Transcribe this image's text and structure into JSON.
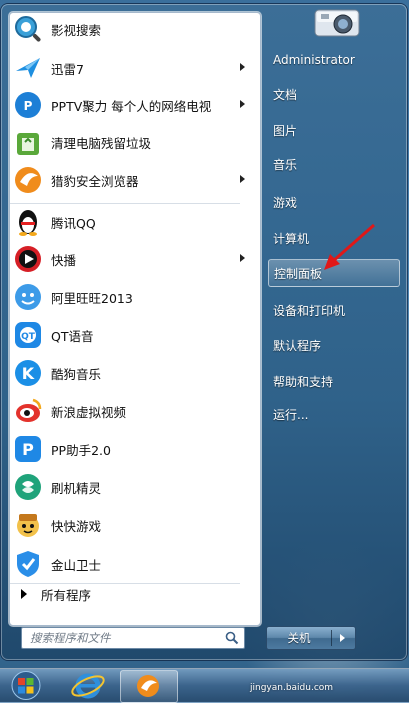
{
  "programs": [
    {
      "label": "影视搜索",
      "icon": "film-search-icon",
      "arrow": false
    },
    {
      "label": "迅雷7",
      "icon": "xunlei-bird-icon",
      "arrow": true
    },
    {
      "label": "PPTV聚力 每个人的网络电视",
      "icon": "pptv-icon",
      "arrow": true
    },
    {
      "label": "清理电脑残留垃圾",
      "icon": "recycle-bin-icon",
      "arrow": false
    },
    {
      "label": "猎豹安全浏览器",
      "icon": "cheetah-browser-icon",
      "arrow": true
    },
    {
      "label": "腾讯QQ",
      "icon": "qq-penguin-icon",
      "arrow": false
    },
    {
      "label": "快播",
      "icon": "qvod-play-icon",
      "arrow": true
    },
    {
      "label": "阿里旺旺2013",
      "icon": "aliwangwang-icon",
      "arrow": false
    },
    {
      "label": "QT语音",
      "icon": "qt-voice-icon",
      "arrow": false
    },
    {
      "label": "酷狗音乐",
      "icon": "kugou-icon",
      "arrow": false
    },
    {
      "label": "新浪虚拟视频",
      "icon": "sina-eye-icon",
      "arrow": false
    },
    {
      "label": "PP助手2.0",
      "icon": "pp-assistant-icon",
      "arrow": false
    },
    {
      "label": "刷机精灵",
      "icon": "shuaji-shield-icon",
      "arrow": false
    },
    {
      "label": "快快游戏",
      "icon": "game-character-icon",
      "arrow": false
    },
    {
      "label": "金山卫士",
      "icon": "kingsoft-shield-icon",
      "arrow": false
    }
  ],
  "all_programs": "所有程序",
  "search": {
    "placeholder": "搜索程序和文件"
  },
  "right_items": [
    {
      "label": "Administrator"
    },
    {
      "label": "文档"
    },
    {
      "label": "图片"
    },
    {
      "label": "音乐"
    },
    {
      "label": "游戏"
    },
    {
      "label": "计算机"
    },
    {
      "label": "控制面板"
    },
    {
      "label": "设备和打印机"
    },
    {
      "label": "默认程序"
    },
    {
      "label": "帮助和支持"
    },
    {
      "label": "运行..."
    }
  ],
  "shutdown": {
    "label": "关机"
  },
  "watermark": {
    "text": "jingyan.baidu.com"
  }
}
